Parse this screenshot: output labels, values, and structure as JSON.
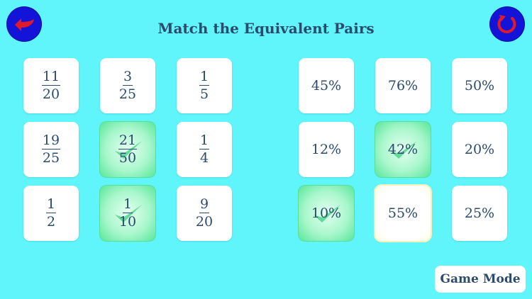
{
  "header": {
    "title": "Match the Equivalent Pairs",
    "back_icon": "back-arrow-icon",
    "restart_icon": "restart-icon"
  },
  "fractions": [
    {
      "numerator": "11",
      "denominator": "20",
      "state": "normal"
    },
    {
      "numerator": "3",
      "denominator": "25",
      "state": "normal"
    },
    {
      "numerator": "1",
      "denominator": "5",
      "state": "normal"
    },
    {
      "numerator": "19",
      "denominator": "25",
      "state": "normal"
    },
    {
      "numerator": "21",
      "denominator": "50",
      "state": "matched"
    },
    {
      "numerator": "1",
      "denominator": "4",
      "state": "normal"
    },
    {
      "numerator": "1",
      "denominator": "2",
      "state": "normal"
    },
    {
      "numerator": "1",
      "denominator": "10",
      "state": "matched"
    },
    {
      "numerator": "9",
      "denominator": "20",
      "state": "normal"
    }
  ],
  "percents": [
    {
      "label": "45%",
      "state": "normal"
    },
    {
      "label": "76%",
      "state": "normal"
    },
    {
      "label": "50%",
      "state": "normal"
    },
    {
      "label": "12%",
      "state": "normal"
    },
    {
      "label": "42%",
      "state": "matched"
    },
    {
      "label": "20%",
      "state": "normal"
    },
    {
      "label": "10%",
      "state": "matched"
    },
    {
      "label": "55%",
      "state": "selected"
    },
    {
      "label": "25%",
      "state": "normal"
    }
  ],
  "footer": {
    "game_mode_label": "Game Mode"
  },
  "colors": {
    "background": "#5ff5fb",
    "button_blue": "#1414d8",
    "icon_red": "#e11a2a",
    "matched_green": "#57e69a",
    "text": "#2b4a6c"
  }
}
